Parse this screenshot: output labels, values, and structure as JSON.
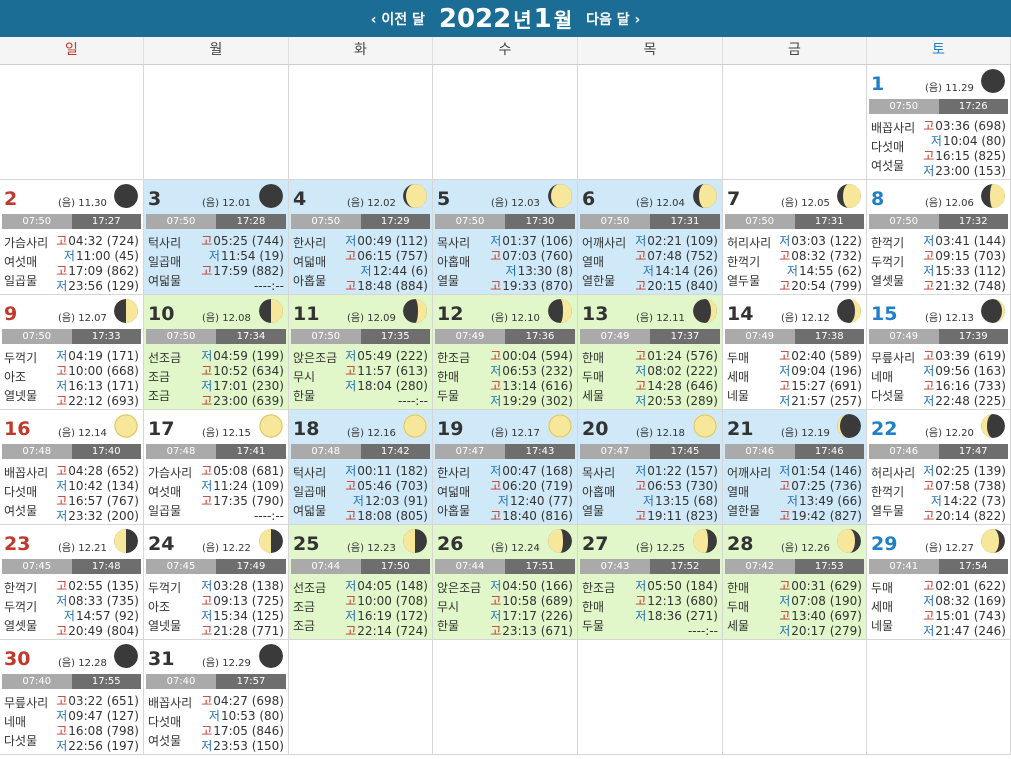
{
  "header": {
    "prev_label": "‹ 이전 달",
    "next_label": "다음 달 ›",
    "year": "2022",
    "year_suffix": "년",
    "month": "1",
    "month_suffix": "월"
  },
  "weekdays": [
    "일",
    "월",
    "화",
    "수",
    "목",
    "금",
    "토"
  ],
  "colors": {
    "header": "#1b6d96",
    "sunday": "#c0392b",
    "saturday": "#1f7fc9",
    "highlight_blue": "#cfe9f8",
    "highlight_green": "#e1f7c9",
    "high_tide": "#c0392b",
    "low_tide": "#1f6fb8"
  },
  "lunar_prefix": "(음)",
  "days": [
    {
      "day": "1",
      "lunar": "11.29",
      "sunrise": "07:50",
      "sunset": "17:26",
      "moon": "new",
      "mul": [
        "배꼽사리",
        "다섯매",
        "여섯물"
      ],
      "tides": [
        {
          "k": "고",
          "t": "03:36",
          "h": "(698)"
        },
        {
          "k": "저",
          "t": "10:04",
          "h": "(80)"
        },
        {
          "k": "고",
          "t": "16:15",
          "h": "(825)"
        },
        {
          "k": "저",
          "t": "23:00",
          "h": "(153)"
        }
      ]
    },
    {
      "day": "2",
      "lunar": "11.30",
      "sunrise": "07:50",
      "sunset": "17:27",
      "moon": "new",
      "mul": [
        "가슴사리",
        "여섯매",
        "일곱물"
      ],
      "tides": [
        {
          "k": "고",
          "t": "04:32",
          "h": "(724)"
        },
        {
          "k": "저",
          "t": "11:00",
          "h": "(45)"
        },
        {
          "k": "고",
          "t": "17:09",
          "h": "(862)"
        },
        {
          "k": "저",
          "t": "23:56",
          "h": "(129)"
        }
      ]
    },
    {
      "day": "3",
      "lunar": "12.01",
      "sunrise": "07:50",
      "sunset": "17:28",
      "moon": "new",
      "mul": [
        "턱사리",
        "일곱매",
        "여덟물"
      ],
      "tides": [
        {
          "k": "고",
          "t": "05:25",
          "h": "(744)"
        },
        {
          "k": "저",
          "t": "11:54",
          "h": "(19)"
        },
        {
          "k": "고",
          "t": "17:59",
          "h": "(882)"
        },
        {
          "k": "",
          "t": "----:--",
          "h": ""
        }
      ]
    },
    {
      "day": "4",
      "lunar": "12.02",
      "sunrise": "07:50",
      "sunset": "17:29",
      "moon": "crescent-1",
      "mul": [
        "한사리",
        "여덟매",
        "아홉물"
      ],
      "tides": [
        {
          "k": "저",
          "t": "00:49",
          "h": "(112)"
        },
        {
          "k": "고",
          "t": "06:15",
          "h": "(757)"
        },
        {
          "k": "저",
          "t": "12:44",
          "h": "(6)"
        },
        {
          "k": "고",
          "t": "18:48",
          "h": "(884)"
        }
      ]
    },
    {
      "day": "5",
      "lunar": "12.03",
      "sunrise": "07:50",
      "sunset": "17:30",
      "moon": "crescent-1",
      "mul": [
        "목사리",
        "아홉매",
        "열물"
      ],
      "tides": [
        {
          "k": "저",
          "t": "01:37",
          "h": "(106)"
        },
        {
          "k": "고",
          "t": "07:03",
          "h": "(760)"
        },
        {
          "k": "저",
          "t": "13:30",
          "h": "(8)"
        },
        {
          "k": "고",
          "t": "19:33",
          "h": "(870)"
        }
      ]
    },
    {
      "day": "6",
      "lunar": "12.04",
      "sunrise": "07:50",
      "sunset": "17:31",
      "moon": "crescent-2",
      "mul": [
        "어깨사리",
        "열매",
        "열한물"
      ],
      "tides": [
        {
          "k": "저",
          "t": "02:21",
          "h": "(109)"
        },
        {
          "k": "고",
          "t": "07:48",
          "h": "(752)"
        },
        {
          "k": "저",
          "t": "14:14",
          "h": "(26)"
        },
        {
          "k": "고",
          "t": "20:15",
          "h": "(840)"
        }
      ]
    },
    {
      "day": "7",
      "lunar": "12.05",
      "sunrise": "07:50",
      "sunset": "17:31",
      "moon": "crescent-2",
      "mul": [
        "허리사리",
        "한꺽기",
        "열두물"
      ],
      "tides": [
        {
          "k": "저",
          "t": "03:03",
          "h": "(122)"
        },
        {
          "k": "고",
          "t": "08:32",
          "h": "(732)"
        },
        {
          "k": "저",
          "t": "14:55",
          "h": "(62)"
        },
        {
          "k": "고",
          "t": "20:54",
          "h": "(799)"
        }
      ]
    },
    {
      "day": "8",
      "lunar": "12.06",
      "sunrise": "07:50",
      "sunset": "17:32",
      "moon": "crescent-3",
      "mul": [
        "한꺽기",
        "두꺽기",
        "열셋물"
      ],
      "tides": [
        {
          "k": "저",
          "t": "03:41",
          "h": "(144)"
        },
        {
          "k": "고",
          "t": "09:15",
          "h": "(703)"
        },
        {
          "k": "저",
          "t": "15:33",
          "h": "(112)"
        },
        {
          "k": "고",
          "t": "21:32",
          "h": "(748)"
        }
      ]
    },
    {
      "day": "9",
      "lunar": "12.07",
      "sunrise": "07:50",
      "sunset": "17:33",
      "moon": "half",
      "mul": [
        "두꺽기",
        "아조",
        "열넷물"
      ],
      "tides": [
        {
          "k": "저",
          "t": "04:19",
          "h": "(171)"
        },
        {
          "k": "고",
          "t": "10:00",
          "h": "(668)"
        },
        {
          "k": "저",
          "t": "16:13",
          "h": "(171)"
        },
        {
          "k": "고",
          "t": "22:12",
          "h": "(693)"
        }
      ]
    },
    {
      "day": "10",
      "lunar": "12.08",
      "sunrise": "07:50",
      "sunset": "17:34",
      "moon": "half",
      "mul": [
        "선조금",
        "조금",
        "조금"
      ],
      "tides": [
        {
          "k": "저",
          "t": "04:59",
          "h": "(199)"
        },
        {
          "k": "고",
          "t": "10:52",
          "h": "(634)"
        },
        {
          "k": "저",
          "t": "17:01",
          "h": "(230)"
        },
        {
          "k": "고",
          "t": "23:00",
          "h": "(639)"
        }
      ]
    },
    {
      "day": "11",
      "lunar": "12.09",
      "sunrise": "07:50",
      "sunset": "17:35",
      "moon": "gibbous-1",
      "mul": [
        "앉은조금",
        "무시",
        "한물"
      ],
      "tides": [
        {
          "k": "저",
          "t": "05:49",
          "h": "(222)"
        },
        {
          "k": "고",
          "t": "11:57",
          "h": "(613)"
        },
        {
          "k": "저",
          "t": "18:04",
          "h": "(280)"
        },
        {
          "k": "",
          "t": "----:--",
          "h": ""
        }
      ]
    },
    {
      "day": "12",
      "lunar": "12.10",
      "sunrise": "07:49",
      "sunset": "17:36",
      "moon": "gibbous-1",
      "mul": [
        "한조금",
        "한매",
        "두물"
      ],
      "tides": [
        {
          "k": "고",
          "t": "00:04",
          "h": "(594)"
        },
        {
          "k": "저",
          "t": "06:53",
          "h": "(232)"
        },
        {
          "k": "고",
          "t": "13:14",
          "h": "(616)"
        },
        {
          "k": "저",
          "t": "19:29",
          "h": "(302)"
        }
      ]
    },
    {
      "day": "13",
      "lunar": "12.11",
      "sunrise": "07:49",
      "sunset": "17:37",
      "moon": "gibbous-2",
      "mul": [
        "한매",
        "두매",
        "세물"
      ],
      "tides": [
        {
          "k": "고",
          "t": "01:24",
          "h": "(576)"
        },
        {
          "k": "저",
          "t": "08:02",
          "h": "(222)"
        },
        {
          "k": "고",
          "t": "14:28",
          "h": "(646)"
        },
        {
          "k": "저",
          "t": "20:53",
          "h": "(289)"
        }
      ]
    },
    {
      "day": "14",
      "lunar": "12.12",
      "sunrise": "07:49",
      "sunset": "17:38",
      "moon": "gibbous-2",
      "mul": [
        "두매",
        "세매",
        "네물"
      ],
      "tides": [
        {
          "k": "고",
          "t": "02:40",
          "h": "(589)"
        },
        {
          "k": "저",
          "t": "09:04",
          "h": "(196)"
        },
        {
          "k": "고",
          "t": "15:27",
          "h": "(691)"
        },
        {
          "k": "저",
          "t": "21:57",
          "h": "(257)"
        }
      ]
    },
    {
      "day": "15",
      "lunar": "12.13",
      "sunrise": "07:49",
      "sunset": "17:39",
      "moon": "gibbous-3",
      "mul": [
        "무릎사리",
        "네매",
        "다섯물"
      ],
      "tides": [
        {
          "k": "고",
          "t": "03:39",
          "h": "(619)"
        },
        {
          "k": "저",
          "t": "09:56",
          "h": "(163)"
        },
        {
          "k": "고",
          "t": "16:16",
          "h": "(733)"
        },
        {
          "k": "저",
          "t": "22:48",
          "h": "(225)"
        }
      ]
    },
    {
      "day": "16",
      "lunar": "12.14",
      "sunrise": "07:48",
      "sunset": "17:40",
      "moon": "full",
      "mul": [
        "배꼽사리",
        "다섯매",
        "여섯물"
      ],
      "tides": [
        {
          "k": "고",
          "t": "04:28",
          "h": "(652)"
        },
        {
          "k": "저",
          "t": "10:42",
          "h": "(134)"
        },
        {
          "k": "고",
          "t": "16:57",
          "h": "(767)"
        },
        {
          "k": "저",
          "t": "23:32",
          "h": "(200)"
        }
      ]
    },
    {
      "day": "17",
      "lunar": "12.15",
      "sunrise": "07:48",
      "sunset": "17:41",
      "moon": "full",
      "mul": [
        "가슴사리",
        "여섯매",
        "일곱물"
      ],
      "tides": [
        {
          "k": "고",
          "t": "05:08",
          "h": "(681)"
        },
        {
          "k": "저",
          "t": "11:24",
          "h": "(109)"
        },
        {
          "k": "고",
          "t": "17:35",
          "h": "(790)"
        },
        {
          "k": "",
          "t": "----:--",
          "h": ""
        }
      ]
    },
    {
      "day": "18",
      "lunar": "12.16",
      "sunrise": "07:48",
      "sunset": "17:42",
      "moon": "full",
      "mul": [
        "턱사리",
        "일곱매",
        "여덟물"
      ],
      "tides": [
        {
          "k": "저",
          "t": "00:11",
          "h": "(182)"
        },
        {
          "k": "고",
          "t": "05:46",
          "h": "(703)"
        },
        {
          "k": "저",
          "t": "12:03",
          "h": "(91)"
        },
        {
          "k": "고",
          "t": "18:08",
          "h": "(805)"
        }
      ]
    },
    {
      "day": "19",
      "lunar": "12.17",
      "sunrise": "07:47",
      "sunset": "17:43",
      "moon": "full",
      "mul": [
        "한사리",
        "여덟매",
        "아홉물"
      ],
      "tides": [
        {
          "k": "저",
          "t": "00:47",
          "h": "(168)"
        },
        {
          "k": "고",
          "t": "06:20",
          "h": "(719)"
        },
        {
          "k": "저",
          "t": "12:40",
          "h": "(77)"
        },
        {
          "k": "고",
          "t": "18:40",
          "h": "(816)"
        }
      ]
    },
    {
      "day": "20",
      "lunar": "12.18",
      "sunrise": "07:47",
      "sunset": "17:45",
      "moon": "full",
      "mul": [
        "목사리",
        "아홉매",
        "열물"
      ],
      "tides": [
        {
          "k": "저",
          "t": "01:22",
          "h": "(157)"
        },
        {
          "k": "고",
          "t": "06:53",
          "h": "(730)"
        },
        {
          "k": "저",
          "t": "13:15",
          "h": "(68)"
        },
        {
          "k": "고",
          "t": "19:11",
          "h": "(823)"
        }
      ]
    },
    {
      "day": "21",
      "lunar": "12.19",
      "sunrise": "07:46",
      "sunset": "17:46",
      "moon": "waning-1",
      "mul": [
        "어깨사리",
        "열매",
        "열한물"
      ],
      "tides": [
        {
          "k": "저",
          "t": "01:54",
          "h": "(146)"
        },
        {
          "k": "고",
          "t": "07:25",
          "h": "(736)"
        },
        {
          "k": "저",
          "t": "13:49",
          "h": "(66)"
        },
        {
          "k": "고",
          "t": "19:42",
          "h": "(827)"
        }
      ]
    },
    {
      "day": "22",
      "lunar": "12.20",
      "sunrise": "07:46",
      "sunset": "17:47",
      "moon": "waning-2",
      "mul": [
        "허리사리",
        "한꺽기",
        "열두물"
      ],
      "tides": [
        {
          "k": "저",
          "t": "02:25",
          "h": "(139)"
        },
        {
          "k": "고",
          "t": "07:58",
          "h": "(738)"
        },
        {
          "k": "저",
          "t": "14:22",
          "h": "(73)"
        },
        {
          "k": "고",
          "t": "20:14",
          "h": "(822)"
        }
      ]
    },
    {
      "day": "23",
      "lunar": "12.21",
      "sunrise": "07:45",
      "sunset": "17:48",
      "moon": "waning-half",
      "mul": [
        "한꺽기",
        "두꺽기",
        "열셋물"
      ],
      "tides": [
        {
          "k": "고",
          "t": "02:55",
          "h": "(135)"
        },
        {
          "k": "저",
          "t": "08:33",
          "h": "(735)"
        },
        {
          "k": "저",
          "t": "14:57",
          "h": "(92)"
        },
        {
          "k": "고",
          "t": "20:49",
          "h": "(804)"
        }
      ]
    },
    {
      "day": "24",
      "lunar": "12.22",
      "sunrise": "07:45",
      "sunset": "17:49",
      "moon": "waning-half",
      "mul": [
        "두꺽기",
        "아조",
        "열넷물"
      ],
      "tides": [
        {
          "k": "저",
          "t": "03:28",
          "h": "(138)"
        },
        {
          "k": "고",
          "t": "09:13",
          "h": "(725)"
        },
        {
          "k": "저",
          "t": "15:34",
          "h": "(125)"
        },
        {
          "k": "고",
          "t": "21:28",
          "h": "(771)"
        }
      ]
    },
    {
      "day": "25",
      "lunar": "12.23",
      "sunrise": "07:44",
      "sunset": "17:50",
      "moon": "waning-half",
      "mul": [
        "선조금",
        "조금",
        "조금"
      ],
      "tides": [
        {
          "k": "저",
          "t": "04:05",
          "h": "(148)"
        },
        {
          "k": "고",
          "t": "10:00",
          "h": "(708)"
        },
        {
          "k": "저",
          "t": "16:19",
          "h": "(172)"
        },
        {
          "k": "고",
          "t": "22:14",
          "h": "(724)"
        }
      ]
    },
    {
      "day": "26",
      "lunar": "12.24",
      "sunrise": "07:44",
      "sunset": "17:51",
      "moon": "waning-3",
      "mul": [
        "앉은조금",
        "무시",
        "한물"
      ],
      "tides": [
        {
          "k": "저",
          "t": "04:50",
          "h": "(166)"
        },
        {
          "k": "고",
          "t": "10:58",
          "h": "(689)"
        },
        {
          "k": "저",
          "t": "17:17",
          "h": "(226)"
        },
        {
          "k": "고",
          "t": "23:13",
          "h": "(671)"
        }
      ]
    },
    {
      "day": "27",
      "lunar": "12.25",
      "sunrise": "07:43",
      "sunset": "17:52",
      "moon": "waning-3",
      "mul": [
        "한조금",
        "한매",
        "두물"
      ],
      "tides": [
        {
          "k": "저",
          "t": "05:50",
          "h": "(184)"
        },
        {
          "k": "고",
          "t": "12:13",
          "h": "(680)"
        },
        {
          "k": "저",
          "t": "18:36",
          "h": "(271)"
        },
        {
          "k": "",
          "t": "----:--",
          "h": ""
        }
      ]
    },
    {
      "day": "28",
      "lunar": "12.26",
      "sunrise": "07:42",
      "sunset": "17:53",
      "moon": "waning-4",
      "mul": [
        "한매",
        "두매",
        "세물"
      ],
      "tides": [
        {
          "k": "고",
          "t": "00:31",
          "h": "(629)"
        },
        {
          "k": "저",
          "t": "07:08",
          "h": "(190)"
        },
        {
          "k": "고",
          "t": "13:40",
          "h": "(697)"
        },
        {
          "k": "저",
          "t": "20:17",
          "h": "(279)"
        }
      ]
    },
    {
      "day": "29",
      "lunar": "12.27",
      "sunrise": "07:41",
      "sunset": "17:54",
      "moon": "waning-4",
      "mul": [
        "두매",
        "세매",
        "네물"
      ],
      "tides": [
        {
          "k": "고",
          "t": "02:01",
          "h": "(622)"
        },
        {
          "k": "저",
          "t": "08:32",
          "h": "(169)"
        },
        {
          "k": "고",
          "t": "15:01",
          "h": "(743)"
        },
        {
          "k": "저",
          "t": "21:47",
          "h": "(246)"
        }
      ]
    },
    {
      "day": "30",
      "lunar": "12.28",
      "sunrise": "07:40",
      "sunset": "17:55",
      "moon": "new",
      "mul": [
        "무릎사리",
        "네매",
        "다섯물"
      ],
      "tides": [
        {
          "k": "고",
          "t": "03:22",
          "h": "(651)"
        },
        {
          "k": "저",
          "t": "09:47",
          "h": "(127)"
        },
        {
          "k": "고",
          "t": "16:08",
          "h": "(798)"
        },
        {
          "k": "저",
          "t": "22:56",
          "h": "(197)"
        }
      ]
    },
    {
      "day": "31",
      "lunar": "12.29",
      "sunrise": "07:40",
      "sunset": "17:57",
      "moon": "new",
      "mul": [
        "배꼽사리",
        "다섯매",
        "여섯물"
      ],
      "tides": [
        {
          "k": "고",
          "t": "04:27",
          "h": "(698)"
        },
        {
          "k": "저",
          "t": "10:53",
          "h": "(80)"
        },
        {
          "k": "고",
          "t": "17:05",
          "h": "(846)"
        },
        {
          "k": "저",
          "t": "23:53",
          "h": "(150)"
        }
      ]
    }
  ],
  "highlight": {
    "blue": [
      "3",
      "4",
      "5",
      "6",
      "18",
      "19",
      "20",
      "21"
    ],
    "green": [
      "10",
      "11",
      "12",
      "13",
      "25",
      "26",
      "27",
      "28"
    ]
  }
}
